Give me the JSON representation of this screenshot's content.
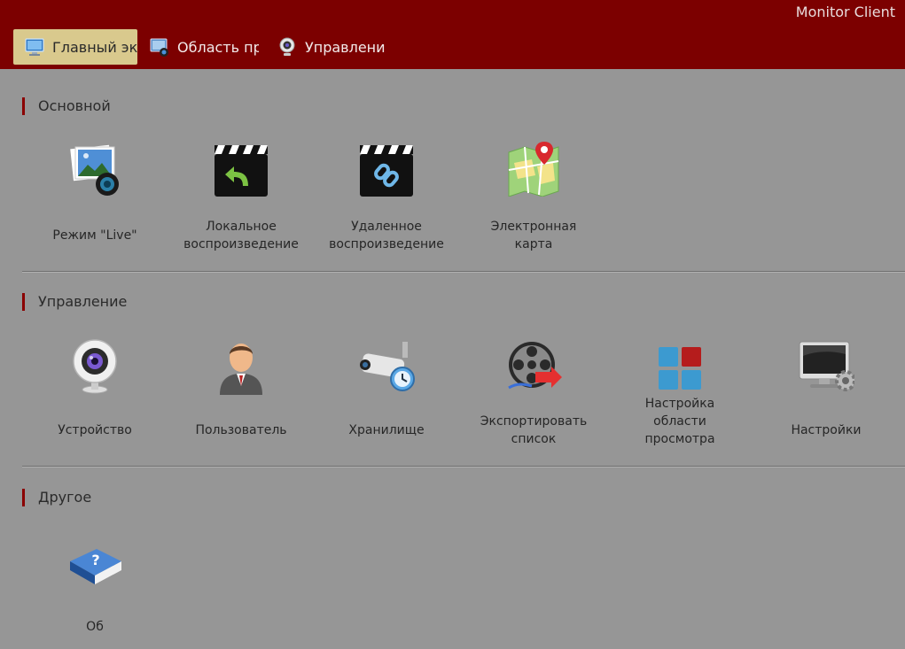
{
  "header": {
    "app_title": "Monitor Client",
    "tabs": [
      {
        "label": "Главный эк",
        "icon": "monitor-icon",
        "active": true
      },
      {
        "label": "Область пр",
        "icon": "view-area-icon",
        "active": false
      },
      {
        "label": "Управлени",
        "icon": "webcam-icon",
        "active": false
      }
    ]
  },
  "sections": [
    {
      "title": "Основной",
      "items": [
        {
          "label": "Режим \"Live\"",
          "icon": "live-view-icon"
        },
        {
          "label": "Локальное\nвоспроизведение",
          "icon": "local-playback-icon"
        },
        {
          "label": "Удаленное\nвоспроизведение",
          "icon": "remote-playback-icon"
        },
        {
          "label": "Электронная\nкарта",
          "icon": "e-map-icon"
        }
      ]
    },
    {
      "title": "Управление",
      "items": [
        {
          "label": "Устройство",
          "icon": "webcam-device-icon"
        },
        {
          "label": "Пользователь",
          "icon": "user-icon"
        },
        {
          "label": "Хранилище",
          "icon": "storage-camera-icon"
        },
        {
          "label": "Экспортировать\nсписок",
          "icon": "export-film-icon"
        },
        {
          "label": "Настройка\nобласти\nпросмотра",
          "icon": "view-layout-icon"
        },
        {
          "label": "Настройки",
          "icon": "settings-monitor-icon"
        }
      ]
    },
    {
      "title": "Другое",
      "items": [
        {
          "label": "Об",
          "icon": "help-book-icon"
        }
      ]
    }
  ],
  "colors": {
    "header_bg": "#7c0000",
    "page_bg": "#969696",
    "active_tab_bg": "#d9c98d",
    "section_accent": "#8a0000"
  }
}
